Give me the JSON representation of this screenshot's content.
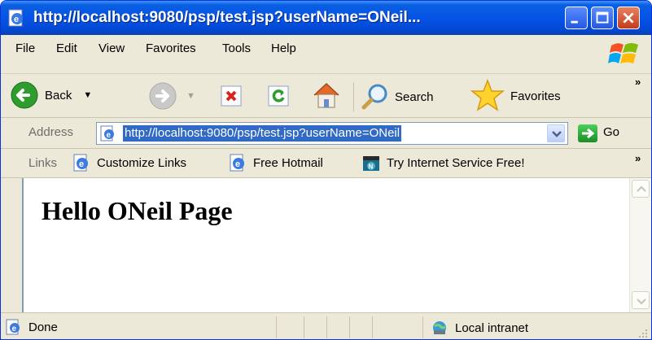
{
  "window": {
    "title": "http://localhost:9080/psp/test.jsp?userName=ONeil..."
  },
  "menu": {
    "items": [
      "File",
      "Edit",
      "View",
      "Favorites",
      "Tools",
      "Help"
    ]
  },
  "toolbar": {
    "back_label": "Back",
    "search_label": "Search",
    "favorites_label": "Favorites"
  },
  "address": {
    "label": "Address",
    "value": "http://localhost:9080/psp/test.jsp?userName=ONeil",
    "go_label": "Go"
  },
  "links": {
    "label": "Links",
    "items": [
      "Customize Links",
      "Free Hotmail",
      "Try Internet Service Free!"
    ]
  },
  "page": {
    "heading": "Hello ONeil Page"
  },
  "status": {
    "text": "Done",
    "zone": "Local intranet"
  },
  "colors": {
    "title_bar": "#0553e6",
    "chrome": "#ece9d8",
    "selection": "#316ac5"
  }
}
